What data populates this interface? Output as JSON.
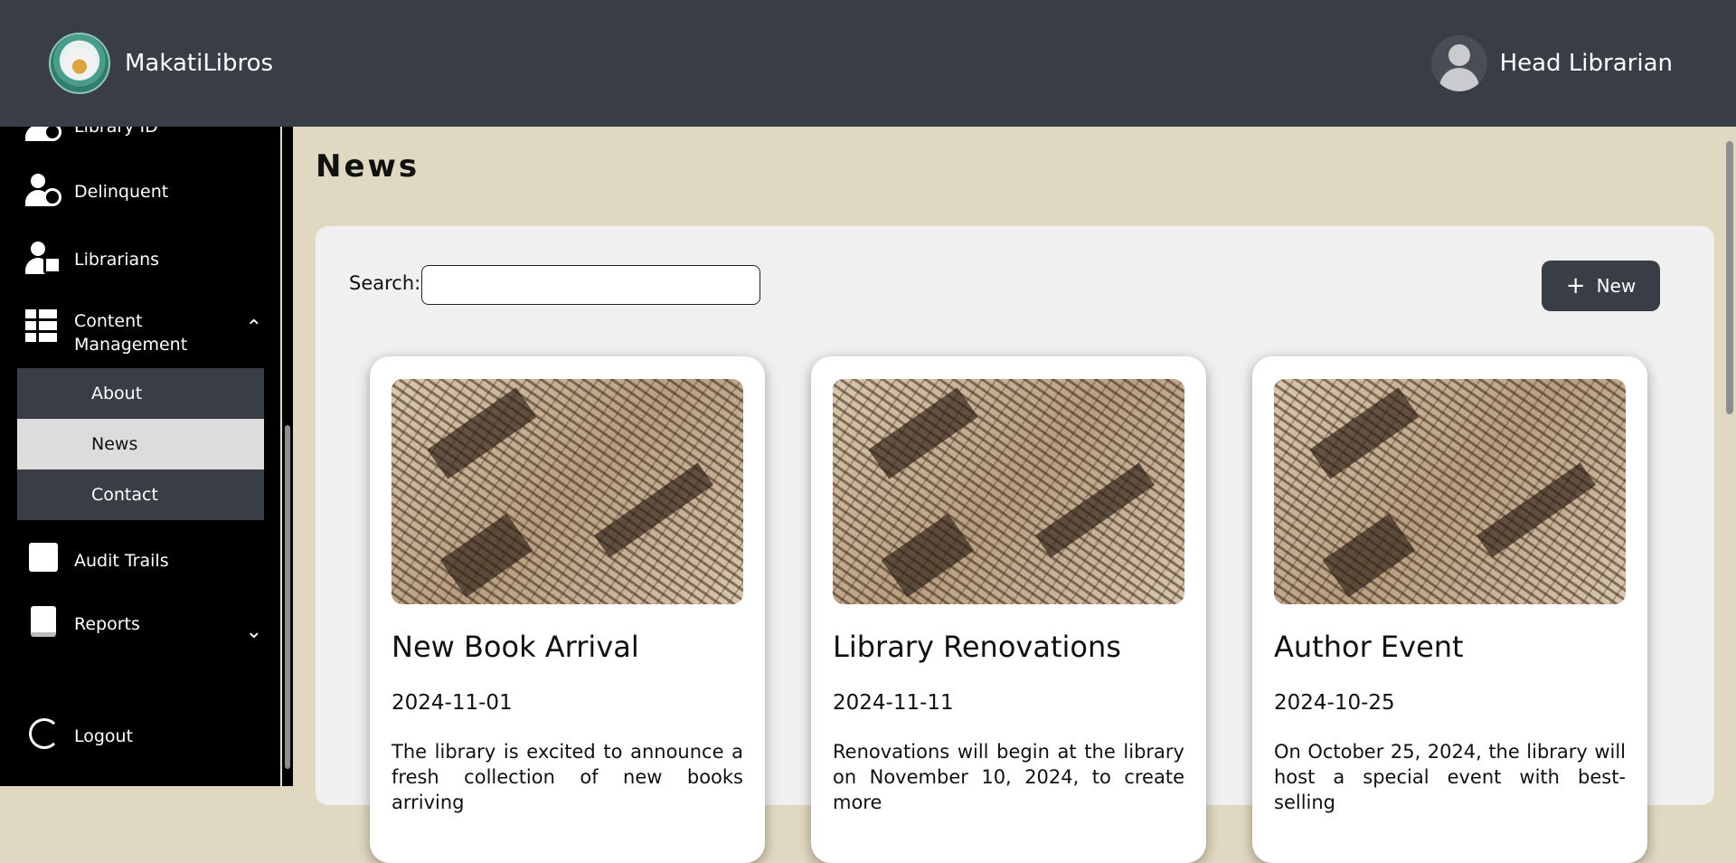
{
  "header": {
    "brand_name": "MakatiLibros",
    "user_name": "Head Librarian"
  },
  "sidebar": {
    "items": [
      {
        "label": "Library ID",
        "icon": "library-id-icon"
      },
      {
        "label": "Delinquent",
        "icon": "delinquent-icon"
      },
      {
        "label": "Librarians",
        "icon": "librarians-icon"
      },
      {
        "label": "Content Management",
        "icon": "content-management-icon",
        "expanded": true
      },
      {
        "label": "Audit Trails",
        "icon": "audit-trails-icon"
      },
      {
        "label": "Reports",
        "icon": "reports-icon",
        "expanded": false
      },
      {
        "label": "Logout",
        "icon": "logout-icon"
      }
    ],
    "submenu": [
      {
        "label": "About",
        "active": false
      },
      {
        "label": "News",
        "active": true
      },
      {
        "label": "Contact",
        "active": false
      }
    ]
  },
  "main": {
    "title": "News",
    "search_label": "Search:",
    "search_value": "",
    "new_button_label": "New",
    "cards": [
      {
        "title": "New Book Arrival",
        "date": "2024-11-01",
        "text": "The library is excited to announce a fresh collection of new books arriving"
      },
      {
        "title": "Library Renovations",
        "date": "2024-11-11",
        "text": "Renovations will begin at the library on November 10, 2024, to create more"
      },
      {
        "title": "Author Event",
        "date": "2024-10-25",
        "text": "On October 25, 2024, the library will host a special event with best-selling"
      }
    ]
  },
  "colors": {
    "header_bg": "#393d46",
    "sidebar_bg": "#000000",
    "page_bg": "#e0d8c0",
    "panel_bg": "#f0f0f0",
    "submenu_active_bg": "#dcdcdc"
  }
}
